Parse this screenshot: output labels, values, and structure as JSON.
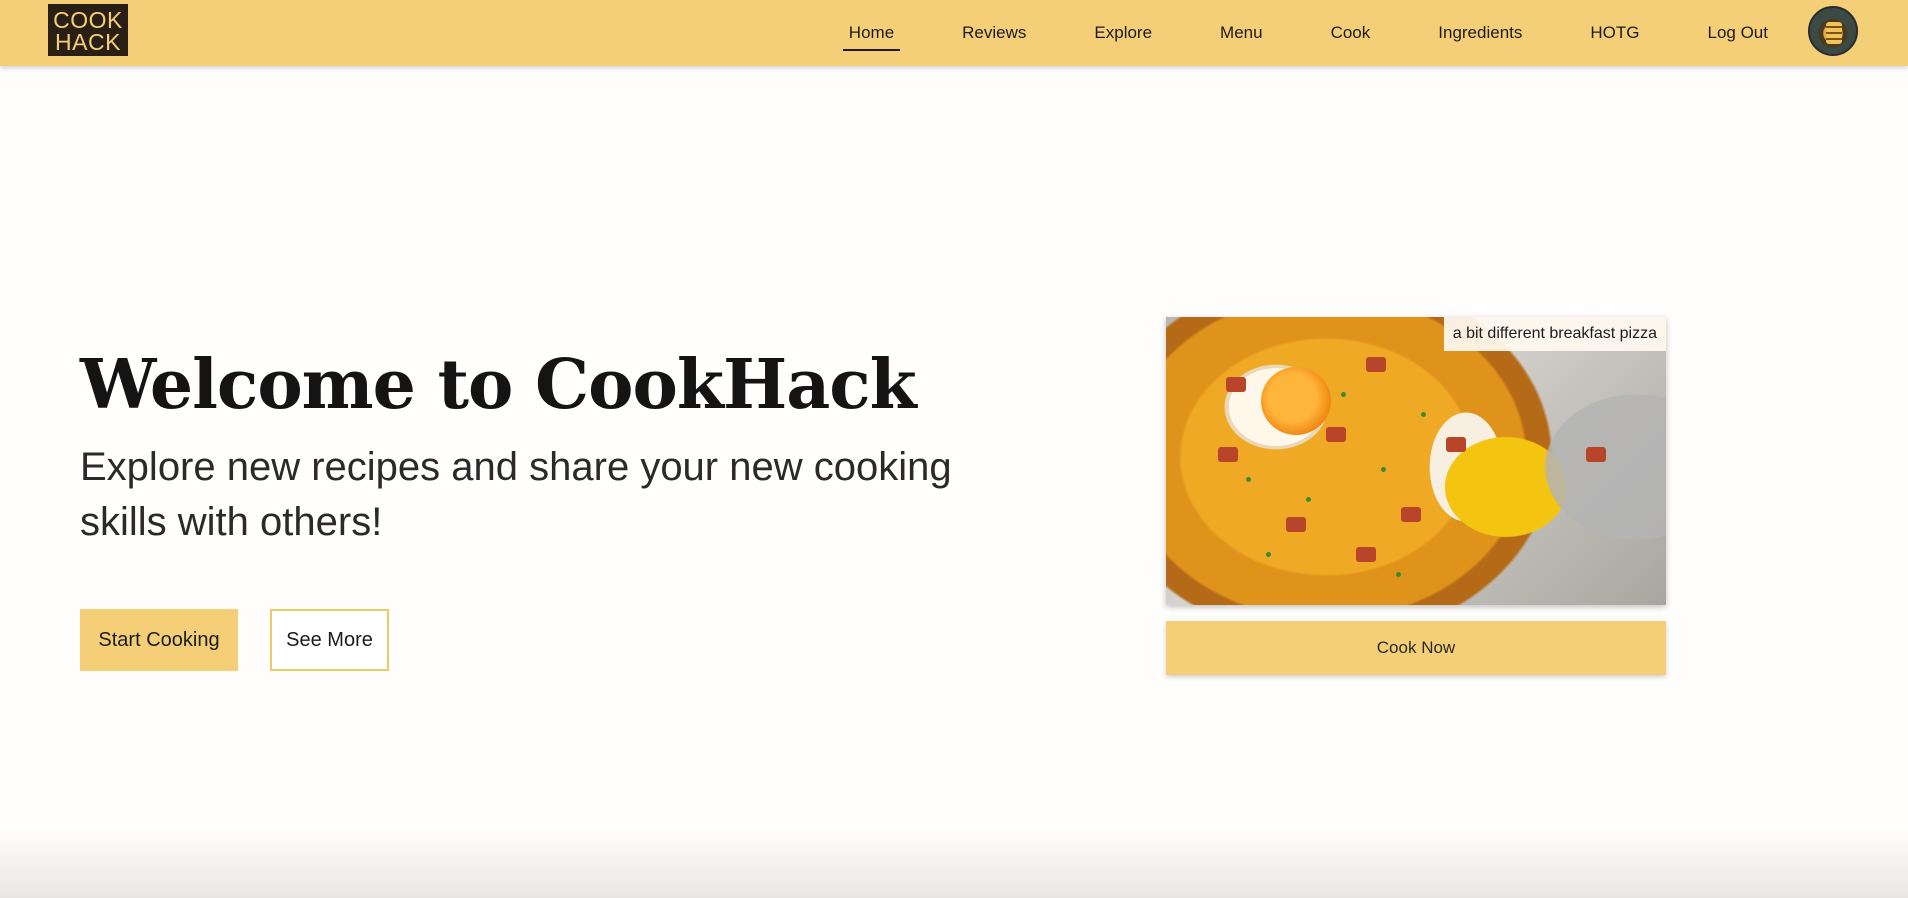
{
  "logo": {
    "line1": "COOK",
    "line2": "HACK"
  },
  "nav": {
    "items": [
      {
        "label": "Home",
        "active": true
      },
      {
        "label": "Reviews"
      },
      {
        "label": "Explore"
      },
      {
        "label": "Menu"
      },
      {
        "label": "Cook"
      },
      {
        "label": "Ingredients"
      },
      {
        "label": "HOTG"
      },
      {
        "label": "Log Out"
      }
    ]
  },
  "hero": {
    "title": "Welcome to CookHack",
    "subtitle": "Explore new recipes and share your new cooking skills with others!",
    "start_label": "Start Cooking",
    "see_more_label": "See More"
  },
  "feature": {
    "caption": "a bit different breakfast pizza",
    "cook_now_label": "Cook Now"
  },
  "colors": {
    "accent": "#f5cf77",
    "logo_bg": "#2a1f14"
  }
}
